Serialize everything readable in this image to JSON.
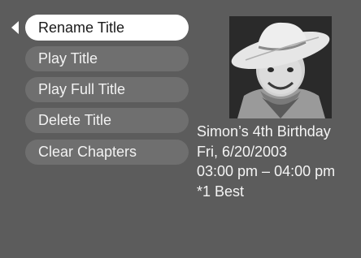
{
  "menu": {
    "items": [
      {
        "label": "Rename Title"
      },
      {
        "label": "Play Title"
      },
      {
        "label": "Play Full Title"
      },
      {
        "label": "Delete Title"
      },
      {
        "label": "Clear Chapters"
      }
    ]
  },
  "title_info": {
    "name": "Simon’s 4th Birthday",
    "date": "Fri, 6/20/2003",
    "time": "03:00 pm – 04:00 pm",
    "quality": "*1 Best"
  },
  "icons": {
    "selector": "left-triangle-pointer"
  },
  "colors": {
    "background": "#5c5c5c",
    "menu_item": "#6f6f6f",
    "menu_selected": "#ffffff",
    "text": "#f2f2f2"
  }
}
